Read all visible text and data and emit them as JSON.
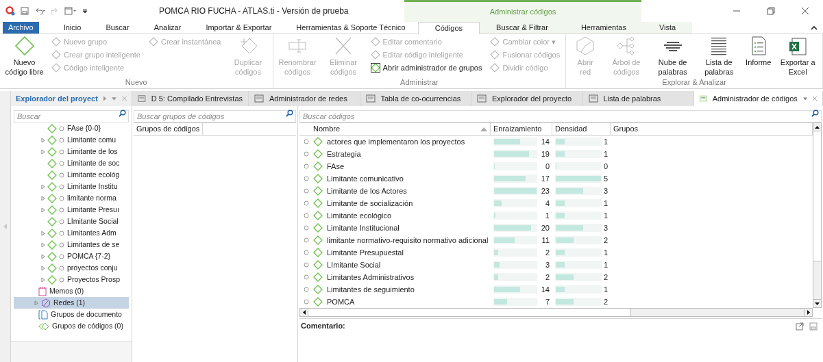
{
  "window": {
    "title": "POMCA RIO FUCHA - ATLAS.ti - Versión de prueba",
    "context_label": "Administrar códigos"
  },
  "menu_tabs": [
    {
      "label": "Archivo",
      "selected": false,
      "kind": "file"
    },
    {
      "label": "Inicio",
      "selected": false,
      "kind": "normal"
    },
    {
      "label": "Buscar",
      "selected": false,
      "kind": "normal"
    },
    {
      "label": "Analizar",
      "selected": false,
      "kind": "normal"
    },
    {
      "label": "Importar & Exportar",
      "selected": false,
      "kind": "normal"
    },
    {
      "label": "Herramientas & Soporte Técnico",
      "selected": false,
      "kind": "normal"
    },
    {
      "label": "Códigos",
      "selected": true,
      "kind": "context"
    },
    {
      "label": "Buscar & Filtrar",
      "selected": false,
      "kind": "context"
    },
    {
      "label": "Herramientas",
      "selected": false,
      "kind": "context"
    },
    {
      "label": "Vista",
      "selected": false,
      "kind": "context"
    }
  ],
  "ribbon": [
    {
      "label": "Nuevo",
      "columns": [
        {
          "kind": "large",
          "label": "Nuevo código libre",
          "disabled": false
        },
        {
          "kind": "stack",
          "items": [
            {
              "label": "Nuevo grupo",
              "disabled": true
            },
            {
              "label": "Crear grupo inteligente",
              "disabled": true
            },
            {
              "label": "Código inteligente",
              "disabled": true
            }
          ]
        },
        {
          "kind": "stack",
          "items": [
            {
              "label": "Crear instantánea",
              "disabled": true
            }
          ]
        },
        {
          "kind": "large",
          "label": "Duplicar códigos",
          "disabled": true
        }
      ]
    },
    {
      "label": "Administrar",
      "columns": [
        {
          "kind": "large",
          "label": "Renombrar códigos",
          "disabled": true
        },
        {
          "kind": "large",
          "label": "Eliminar códigos",
          "disabled": true
        },
        {
          "kind": "stack",
          "items": [
            {
              "label": "Editar comentario",
              "disabled": true
            },
            {
              "label": "Editar código inteligente",
              "disabled": true
            },
            {
              "label": "Abrir administrador de grupos",
              "disabled": false
            }
          ]
        },
        {
          "kind": "stack",
          "items": [
            {
              "label": "Cambiar color ▾",
              "disabled": true
            },
            {
              "label": "Fusionar códigos",
              "disabled": true
            },
            {
              "label": "Dividir código",
              "disabled": true
            }
          ]
        }
      ]
    },
    {
      "label": "Explorar & Analizar",
      "columns": [
        {
          "kind": "large",
          "label": "Abrir red",
          "disabled": true
        },
        {
          "kind": "large",
          "label": "Árbol de códigos",
          "disabled": true
        },
        {
          "kind": "large",
          "label": "Nube de palabras",
          "disabled": false
        },
        {
          "kind": "large",
          "label": "Lista de palabras",
          "disabled": false
        },
        {
          "kind": "large",
          "label": "Informe",
          "disabled": false
        },
        {
          "kind": "large",
          "label": "Exportar a Excel",
          "disabled": false
        }
      ]
    }
  ],
  "explorer": {
    "title": "Explorador del proyect",
    "search_placeholder": "Buscar",
    "codes": [
      {
        "label": "FAse {0-0}",
        "expandable": false
      },
      {
        "label": "Limitante comu",
        "expandable": true
      },
      {
        "label": "Limitante de los",
        "expandable": true
      },
      {
        "label": "Limitante de soc",
        "expandable": false
      },
      {
        "label": "Limitante ecológ",
        "expandable": false
      },
      {
        "label": "Limitante Institu",
        "expandable": true
      },
      {
        "label": "limitante norma",
        "expandable": true
      },
      {
        "label": "Limitante Presuı",
        "expandable": true
      },
      {
        "label": "LImitante Social",
        "expandable": false
      },
      {
        "label": "Limitantes Adm",
        "expandable": true
      },
      {
        "label": "Limitantes de se",
        "expandable": true
      },
      {
        "label": "POMCA {7-2}",
        "expandable": true
      },
      {
        "label": "proyectos conju",
        "expandable": true
      },
      {
        "label": "Proyectos Prosp",
        "expandable": true
      }
    ],
    "sections": [
      {
        "label": "Memos (0)",
        "kind": "memos",
        "expandable": false,
        "selected": false
      },
      {
        "label": "Redes (1)",
        "kind": "networks",
        "expandable": true,
        "selected": true
      },
      {
        "label": "Grupos de documento",
        "kind": "docgroups",
        "expandable": false,
        "selected": false
      },
      {
        "label": "Grupos de códigos (0)",
        "kind": "codegroups",
        "expandable": false,
        "selected": false
      }
    ]
  },
  "doc_tabs": [
    {
      "label": "D 5: Compilado Entrevistas",
      "selected": false
    },
    {
      "label": "Administrador de redes",
      "selected": false
    },
    {
      "label": "Tabla de co-ocurrencias",
      "selected": false
    },
    {
      "label": "Explorador del proyecto",
      "selected": false
    },
    {
      "label": "Lista de palabras",
      "selected": false
    },
    {
      "label": "Administrador de códigos",
      "selected": true
    }
  ],
  "groups_pane": {
    "search_placeholder": "Buscar grupos de códigos",
    "column": "Grupos de códigos"
  },
  "codes_pane": {
    "search_placeholder": "Buscar códigos",
    "columns": [
      "Nombre",
      "Enraizamiento",
      "Densidad",
      "Grupos"
    ],
    "rows": [
      {
        "name": "actores que implementaron los proyectos",
        "groundedness": {
          "value": "14",
          "level": 0.61
        },
        "density": {
          "value": "1",
          "level": 0.2
        }
      },
      {
        "name": "Estrategia",
        "groundedness": {
          "value": "19",
          "level": 0.83
        },
        "density": {
          "value": "1",
          "level": 0.2
        }
      },
      {
        "name": "FAse",
        "groundedness": {
          "value": "0",
          "level": 0
        },
        "density": {
          "value": "0",
          "level": 0
        }
      },
      {
        "name": "Limitante comunicativo",
        "groundedness": {
          "value": "17",
          "level": 0.74
        },
        "density": {
          "value": "5",
          "level": 1
        }
      },
      {
        "name": "Limitante de los Actores",
        "groundedness": {
          "value": "23",
          "level": 1
        },
        "density": {
          "value": "3",
          "level": 0.6
        }
      },
      {
        "name": "Limitante de socialización",
        "groundedness": {
          "value": "4",
          "level": 0.17
        },
        "density": {
          "value": "1",
          "level": 0.2
        }
      },
      {
        "name": "Limitante ecológico",
        "groundedness": {
          "value": "1",
          "level": 0.04
        },
        "density": {
          "value": "1",
          "level": 0.2
        }
      },
      {
        "name": "Limitante Institucional",
        "groundedness": {
          "value": "20",
          "level": 0.87
        },
        "density": {
          "value": "3",
          "level": 0.6
        }
      },
      {
        "name": "limitante normativo-requisito normativo adicional",
        "groundedness": {
          "value": "11",
          "level": 0.48
        },
        "density": {
          "value": "2",
          "level": 0.4
        }
      },
      {
        "name": "Limitante Presupuestal",
        "groundedness": {
          "value": "2",
          "level": 0.09
        },
        "density": {
          "value": "1",
          "level": 0.2
        }
      },
      {
        "name": "LImitante Social",
        "groundedness": {
          "value": "3",
          "level": 0.13
        },
        "density": {
          "value": "1",
          "level": 0.2
        }
      },
      {
        "name": "Limitantes Administrativos",
        "groundedness": {
          "value": "2",
          "level": 0.09
        },
        "density": {
          "value": "2",
          "level": 0.4
        }
      },
      {
        "name": "Limitantes de seguimiento",
        "groundedness": {
          "value": "14",
          "level": 0.61
        },
        "density": {
          "value": "1",
          "level": 0.2
        }
      },
      {
        "name": "POMCA",
        "groundedness": {
          "value": "7",
          "level": 0.3
        },
        "density": {
          "value": "2",
          "level": 0.4
        }
      }
    ],
    "comment_label": "Comentario:"
  }
}
